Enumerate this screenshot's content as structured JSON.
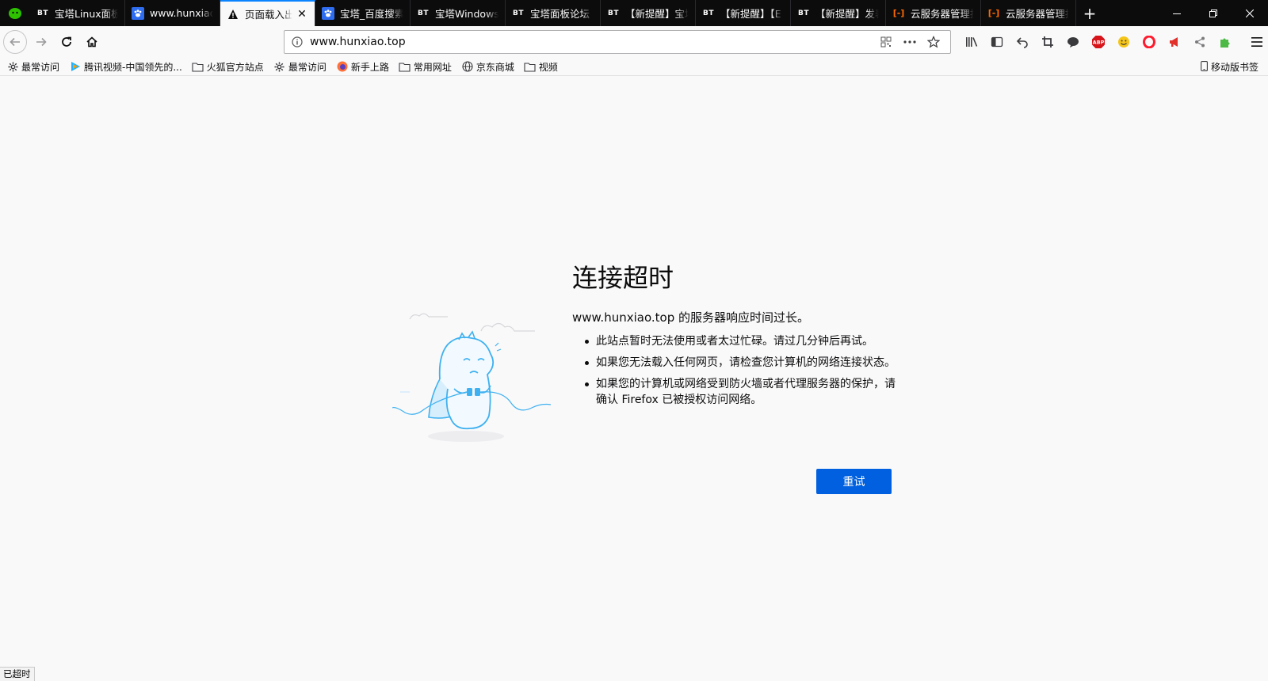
{
  "tabs": [
    {
      "favicon": "bt-icon",
      "title": "宝塔Linux面板",
      "selected": false
    },
    {
      "favicon": "paw-icon",
      "title": "www.hunxiao.top",
      "selected": false
    },
    {
      "favicon": "warning-icon",
      "title": "页面载入出错",
      "selected": true
    },
    {
      "favicon": "paw-icon",
      "title": "宝塔_百度搜索",
      "selected": false
    },
    {
      "favicon": "bt-icon",
      "title": "宝塔Windows面板",
      "selected": false
    },
    {
      "favicon": "bt-icon",
      "title": "宝塔面板论坛 -",
      "selected": false
    },
    {
      "favicon": "bt-icon",
      "title": "【新提醒】宝塔",
      "selected": false
    },
    {
      "favicon": "bt-icon",
      "title": "【新提醒】【E",
      "selected": false
    },
    {
      "favicon": "bt-icon",
      "title": "【新提醒】发表",
      "selected": false
    },
    {
      "favicon": "cloud-icon",
      "title": "云服务器管理控",
      "selected": false
    },
    {
      "favicon": "cloud-icon",
      "title": "云服务器管理控",
      "selected": false
    }
  ],
  "favicon_text": {
    "bt": "BT",
    "cloud": "[-]"
  },
  "urlbar": {
    "url": "www.hunxiao.top"
  },
  "bookmarks": [
    {
      "icon": "gear-icon",
      "label": "最常访问"
    },
    {
      "icon": "tencent-video-icon",
      "label": "腾讯视频-中国领先的..."
    },
    {
      "icon": "folder-icon",
      "label": "火狐官方站点"
    },
    {
      "icon": "gear-icon",
      "label": "最常访问"
    },
    {
      "icon": "firefox-icon",
      "label": "新手上路"
    },
    {
      "icon": "folder-icon",
      "label": "常用网址"
    },
    {
      "icon": "globe-icon",
      "label": "京东商城"
    },
    {
      "icon": "folder-icon",
      "label": "视频"
    }
  ],
  "mobile_bookmarks": "移动版书签",
  "error": {
    "title": "连接超时",
    "description": "www.hunxiao.top 的服务器响应时间过长。",
    "suggestions": [
      "此站点暂时无法使用或者太过忙碌。请过几分钟后再试。",
      "如果您无法载入任何网页，请检查您计算机的网络连接状态。",
      "如果您的计算机或网络受到防火墙或者代理服务器的保护，请确认 Firefox 已被授权访问网络。"
    ],
    "retry_label": "重试"
  },
  "status": "已超时",
  "colors": {
    "accent": "#0060df",
    "tab_highlight": "#0a84ff",
    "tabstrip": "#0c0c0d"
  }
}
